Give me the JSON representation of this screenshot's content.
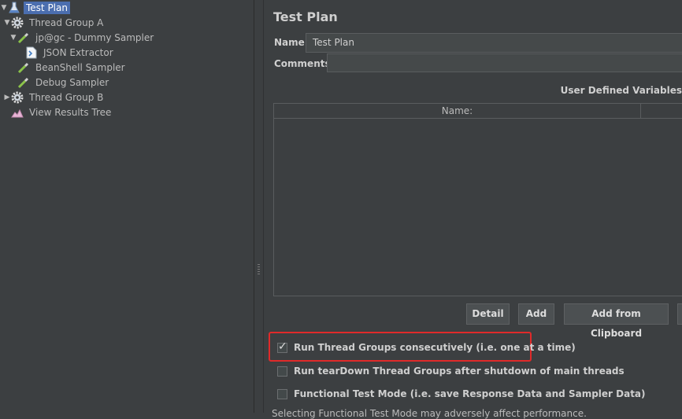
{
  "tree": {
    "items": [
      {
        "label": "Test Plan",
        "icon": "flask-icon",
        "arrow": "▼"
      },
      {
        "label": "Thread Group A",
        "icon": "gear-icon",
        "arrow": "▼"
      },
      {
        "label": "jp@gc - Dummy Sampler",
        "icon": "pipette-icon",
        "arrow": "▼"
      },
      {
        "label": "JSON Extractor",
        "icon": "document-icon",
        "arrow": ""
      },
      {
        "label": "BeanShell Sampler",
        "icon": "pipette-icon",
        "arrow": ""
      },
      {
        "label": "Debug Sampler",
        "icon": "pipette-icon",
        "arrow": ""
      },
      {
        "label": "Thread Group B",
        "icon": "gear-icon",
        "arrow": "▶"
      },
      {
        "label": "View Results Tree",
        "icon": "chart-icon",
        "arrow": ""
      }
    ]
  },
  "panel": {
    "title": "Test Plan",
    "name_label": "Name:",
    "name_value": "Test Plan",
    "comments_label": "Comments:",
    "udv_title": "User Defined Variables",
    "table_header_name": "Name:"
  },
  "buttons": {
    "detail": "Detail",
    "add": "Add",
    "add_clipboard": "Add from Clipboard"
  },
  "options": {
    "run_consecutively": {
      "label": "Run Thread Groups consecutively (i.e. one at a time)",
      "checked": true
    },
    "teardown": {
      "label": "Run tearDown Thread Groups after shutdown of main threads",
      "checked": false
    },
    "functional": {
      "label": "Functional Test Mode (i.e. save Response Data and Sampler Data)",
      "checked": false
    }
  },
  "note": "Selecting Functional Test Mode may adversely affect performance.",
  "colors": {
    "selection": "#4b6eaf",
    "highlight": "#e02a2a",
    "background": "#3c3f41"
  }
}
